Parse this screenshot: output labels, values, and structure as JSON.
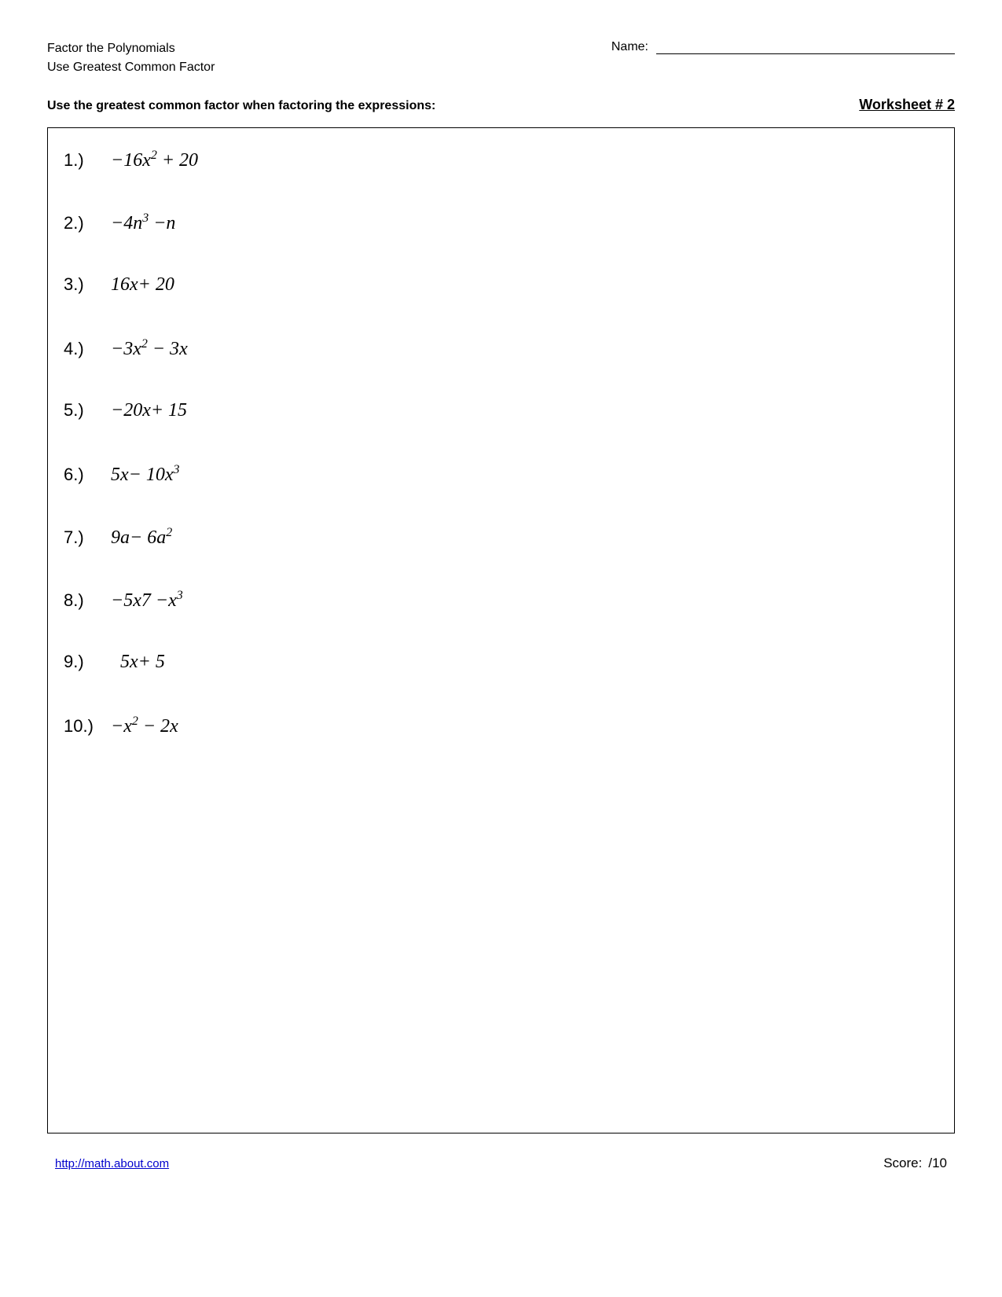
{
  "header": {
    "title_line1": "Factor the Polynomials",
    "title_line2": "Use Greatest Common Factor",
    "name_label": "Name:",
    "name_line_placeholder": ""
  },
  "instruction": {
    "text": "Use the greatest common factor when factoring the expressions:",
    "worksheet_title": "Worksheet # 2"
  },
  "problems": [
    {
      "number": "1.)",
      "expr_html": "&minus;16<i>x</i><sup>2</sup> + 20"
    },
    {
      "number": "2.)",
      "expr_html": "&minus;4<i>n</i><sup>3</sup> &minus;<i>n</i>"
    },
    {
      "number": "3.)",
      "expr_html": "16<i>x</i>+ 20"
    },
    {
      "number": "4.)",
      "expr_html": "&minus;3<i>x</i><sup>2</sup> &minus; 3<i>x</i>"
    },
    {
      "number": "5.)",
      "expr_html": "&minus;20<i>x</i>+ 15"
    },
    {
      "number": "6.)",
      "expr_html": "5<i>x</i>&minus; 10<i>x</i><sup>3</sup>"
    },
    {
      "number": "7.)",
      "expr_html": "9<i>a</i>&minus; 6<i>a</i><sup>2</sup>"
    },
    {
      "number": "8.)",
      "expr_html": "&minus;5<i>x</i>7 &minus;<i>x</i><sup>3</sup>"
    },
    {
      "number": "9.)",
      "expr_html": "&nbsp;&nbsp;5<i>x</i>+ 5"
    },
    {
      "number": "10.)",
      "expr_html": "&minus;<i>x</i><sup>2</sup> &minus; 2<i>x</i>"
    }
  ],
  "footer": {
    "link_text": "http://math.about.com",
    "score_label": "Score:",
    "score_value": "/10"
  }
}
